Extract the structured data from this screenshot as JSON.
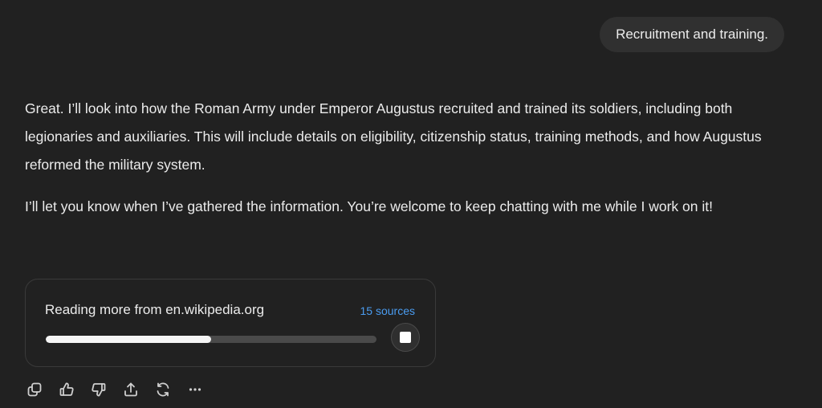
{
  "conversation": {
    "user_message": "Recruitment and training.",
    "assistant_paragraphs": [
      "Great. I’ll look into how the Roman Army under Emperor Augustus recruited and trained its soldiers, including both legionaries and auxiliaries. This will include details on eligibility, citizenship status, training methods, and how Augustus reformed the military system.",
      "I’ll let you know when I’ve gathered the information. You’re welcome to keep chatting with me while I work on it!"
    ]
  },
  "research_progress": {
    "status_text": "Reading more from en.wikipedia.org",
    "sources_label": "15 sources",
    "progress_fraction": 0.5,
    "stop_icon": "stop-square-icon"
  },
  "message_actions": [
    {
      "name": "copy-button",
      "icon": "copy-icon"
    },
    {
      "name": "good-response-button",
      "icon": "thumbs-up-icon"
    },
    {
      "name": "bad-response-button",
      "icon": "thumbs-down-icon"
    },
    {
      "name": "share-button",
      "icon": "share-icon"
    },
    {
      "name": "regenerate-button",
      "icon": "refresh-icon"
    },
    {
      "name": "more-options-button",
      "icon": "more-horizontal-icon"
    }
  ],
  "colors": {
    "background": "#212121",
    "user_bubble": "#303030",
    "link": "#4a9cf0",
    "progress_fill": "#f5f5f5",
    "progress_track": "#4a4a4a"
  }
}
